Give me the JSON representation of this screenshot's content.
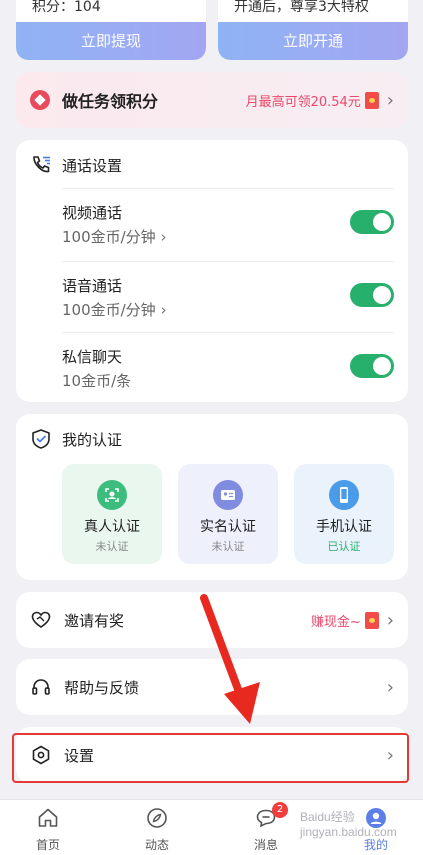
{
  "top_cards": [
    {
      "cut_text": "积分：104",
      "button": "立即提现"
    },
    {
      "cut_text": "开通后，尊享3大特权",
      "button": "立即开通"
    }
  ],
  "task": {
    "title": "做任务领积分",
    "hint": "月最高可领20.54元"
  },
  "call_settings": {
    "title": "通话设置",
    "rows": [
      {
        "name": "视频通话",
        "price": "100金币/分钟",
        "enabled": true
      },
      {
        "name": "语音通话",
        "price": "100金币/分钟",
        "enabled": true
      },
      {
        "name": "私信聊天",
        "price": "10金币/条",
        "enabled": true
      }
    ]
  },
  "certification": {
    "title": "我的认证",
    "items": [
      {
        "name": "真人认证",
        "status": "未认证"
      },
      {
        "name": "实名认证",
        "status": "未认证"
      },
      {
        "name": "手机认证",
        "status": "已认证"
      }
    ]
  },
  "invite": {
    "title": "邀请有奖",
    "hint": "赚现金~"
  },
  "help": {
    "title": "帮助与反馈"
  },
  "settings": {
    "title": "设置"
  },
  "nav": {
    "items": [
      {
        "label": "首页"
      },
      {
        "label": "动态"
      },
      {
        "label": "消息",
        "badge": "2"
      },
      {
        "label": "我的"
      }
    ]
  },
  "watermark": "Baidu经验 jingyan.baidu.com",
  "colors": {
    "accent_red": "#e8496a",
    "toggle_green": "#27b06c",
    "highlight_box": "#e53935",
    "arrow": "#e8291f"
  }
}
